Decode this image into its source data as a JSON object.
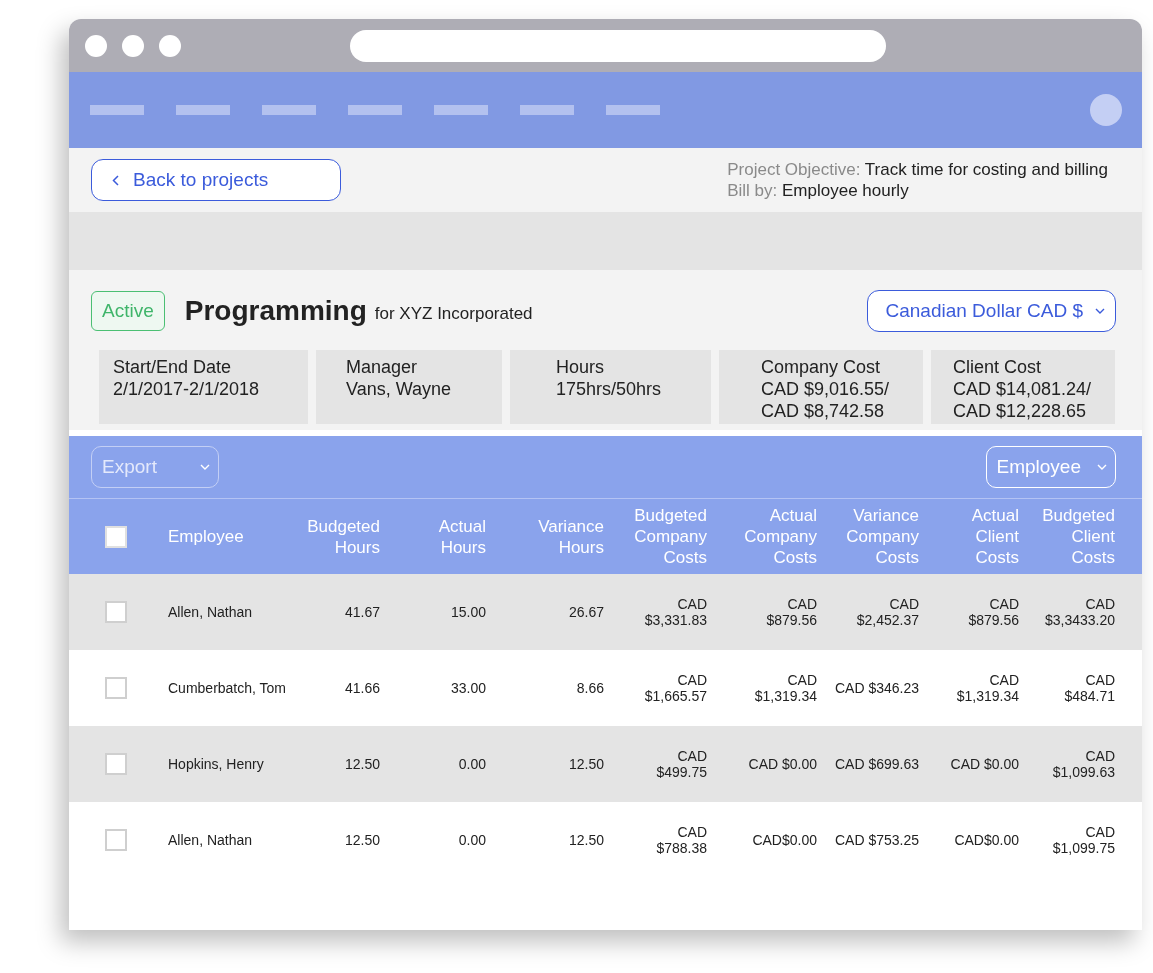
{
  "toolbar": {
    "back_button": "Back to projects",
    "objective_label": "Project Objective:",
    "objective": "Track time for costing and billing",
    "bill_by_label": "Bill by:",
    "bill_by": "Employee hourly"
  },
  "project": {
    "status": "Active",
    "name": "Programming",
    "client": "for XYZ Incorporated",
    "currency": "Canadian Dollar CAD $",
    "info": [
      {
        "label": "Start/End Date",
        "lines": [
          "2/1/2017-2/1/2018"
        ]
      },
      {
        "label": "Manager",
        "lines": [
          "Vans, Wayne"
        ]
      },
      {
        "label": "Hours",
        "lines": [
          "175hrs/50hrs"
        ]
      },
      {
        "label": "Company Cost",
        "lines": [
          "CAD $9,016.55/",
          "CAD $8,742.58"
        ]
      },
      {
        "label": "Client Cost",
        "lines": [
          "CAD $14,081.24/",
          "CAD $12,228.65"
        ]
      }
    ]
  },
  "table_toolbar": {
    "export": {
      "label": "Export",
      "disabled": true
    },
    "group_by": {
      "label": "Employee",
      "disabled": false
    }
  },
  "table": {
    "all_checked": false,
    "columns": [
      "Employee",
      "Budgeted\nHours",
      "Actual\nHours",
      "Variance\nHours",
      "Budgeted\nCompany\nCosts",
      "Actual\nCompany\nCosts",
      "Variance\nCompany\nCosts",
      "Actual\nClient\nCosts",
      "Budgeted\nClient\nCosts"
    ],
    "rows": [
      {
        "checked": false,
        "cells": [
          "Allen, Nathan",
          "41.67",
          "15.00",
          "26.67",
          "CAD\n$3,331.83",
          "CAD\n$879.56",
          "CAD\n$2,452.37",
          "CAD\n$879.56",
          "CAD\n$3,3433.20"
        ]
      },
      {
        "checked": false,
        "cells": [
          "Cumberbatch, Tom",
          "41.66",
          "33.00",
          "8.66",
          "CAD\n$1,665.57",
          "CAD\n$1,319.34",
          "CAD $346.23",
          "CAD\n$1,319.34",
          "CAD\n$484.71"
        ]
      },
      {
        "checked": false,
        "cells": [
          "Hopkins, Henry",
          "12.50",
          "0.00",
          "12.50",
          "CAD\n$499.75",
          "CAD $0.00",
          "CAD $699.63",
          "CAD $0.00",
          "CAD\n$1,099.63"
        ]
      },
      {
        "checked": false,
        "cells": [
          "Allen, Nathan",
          "12.50",
          "0.00",
          "12.50",
          "CAD\n$788.38",
          "CAD$0.00",
          "CAD $753.25",
          "CAD$0.00",
          "CAD\n$1,099.75"
        ]
      }
    ]
  }
}
